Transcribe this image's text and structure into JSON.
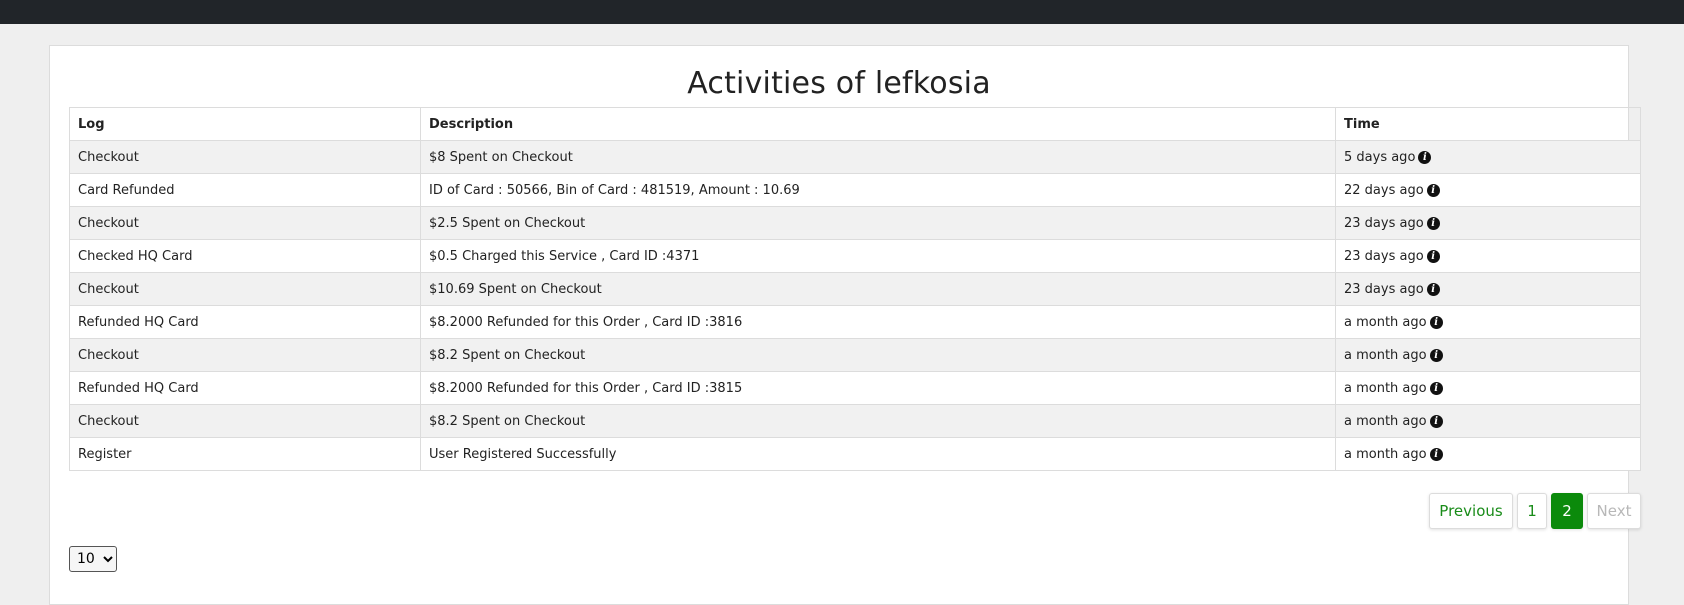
{
  "page": {
    "title": "Activities of lefkosia"
  },
  "table": {
    "headers": [
      "Log",
      "Description",
      "Time"
    ],
    "rows": [
      {
        "log": "Checkout",
        "description": "$8 Spent on Checkout",
        "time": "5 days ago"
      },
      {
        "log": "Card Refunded",
        "description": "ID of Card : 50566, Bin of Card : 481519, Amount : 10.69",
        "time": "22 days ago"
      },
      {
        "log": "Checkout",
        "description": "$2.5 Spent on Checkout",
        "time": "23 days ago"
      },
      {
        "log": "Checked HQ Card",
        "description": "$0.5 Charged this Service , Card ID :4371",
        "time": "23 days ago"
      },
      {
        "log": "Checkout",
        "description": "$10.69 Spent on Checkout",
        "time": "23 days ago"
      },
      {
        "log": "Refunded HQ Card",
        "description": "$8.2000 Refunded for this Order , Card ID :3816",
        "time": "a month ago"
      },
      {
        "log": "Checkout",
        "description": "$8.2 Spent on Checkout",
        "time": "a month ago"
      },
      {
        "log": "Refunded HQ Card",
        "description": "$8.2000 Refunded for this Order , Card ID :3815",
        "time": "a month ago"
      },
      {
        "log": "Checkout",
        "description": "$8.2 Spent on Checkout",
        "time": "a month ago"
      },
      {
        "log": "Register",
        "description": "User Registered Successfully",
        "time": "a month ago"
      }
    ]
  },
  "icons": {
    "time_info": "info-icon"
  },
  "pagination": {
    "previous_label": "Previous",
    "pages": [
      "1",
      "2"
    ],
    "current_page": "2",
    "next_label": "Next"
  },
  "page_size": {
    "selected": "10"
  },
  "colors": {
    "topbar": "#212529",
    "accent_green": "#0b8a0b",
    "pager_text_green": "#198c19"
  }
}
